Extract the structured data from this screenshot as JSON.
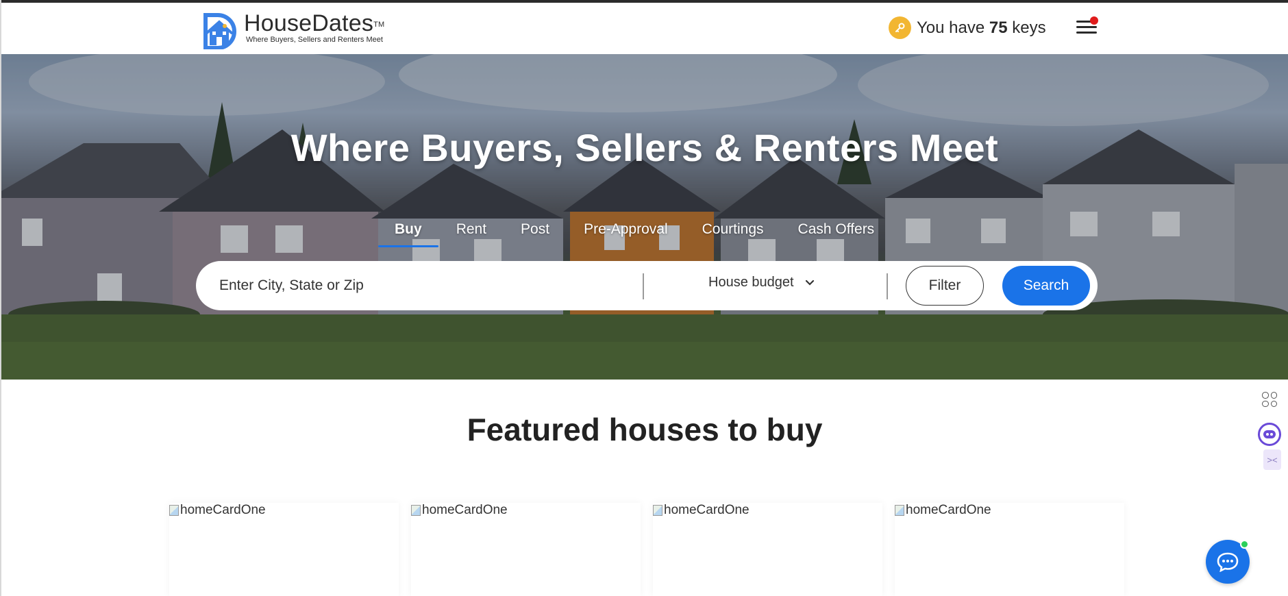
{
  "header": {
    "brand_name": "HouseDates",
    "brand_tm": "TM",
    "brand_tagline": "Where Buyers, Sellers and Renters Meet",
    "keys_prefix": "You have",
    "keys_count": "75",
    "keys_suffix": "keys",
    "icons": {
      "key": "key-icon",
      "menu": "hamburger-menu-icon",
      "notification": "notification-dot"
    }
  },
  "hero": {
    "title": "Where Buyers, Sellers & Renters Meet",
    "tabs": [
      {
        "label": "Buy",
        "active": true
      },
      {
        "label": "Rent",
        "active": false
      },
      {
        "label": "Post",
        "active": false
      },
      {
        "label": "Pre-Approval",
        "active": false
      },
      {
        "label": "Courtings",
        "active": false
      },
      {
        "label": "Cash Offers",
        "active": false
      }
    ],
    "search": {
      "placeholder": "Enter City, State or Zip",
      "budget_label": "House budget",
      "filter_label": "Filter",
      "search_label": "Search"
    }
  },
  "featured": {
    "title": "Featured houses to buy",
    "cards": [
      {
        "img_alt": "homeCardOne"
      },
      {
        "img_alt": "homeCardOne"
      },
      {
        "img_alt": "homeCardOne"
      },
      {
        "img_alt": "homeCardOne"
      }
    ]
  },
  "colors": {
    "accent": "#1a73e8",
    "key_badge": "#f2b632",
    "notification": "#e01c1c",
    "online": "#2bd05a"
  }
}
